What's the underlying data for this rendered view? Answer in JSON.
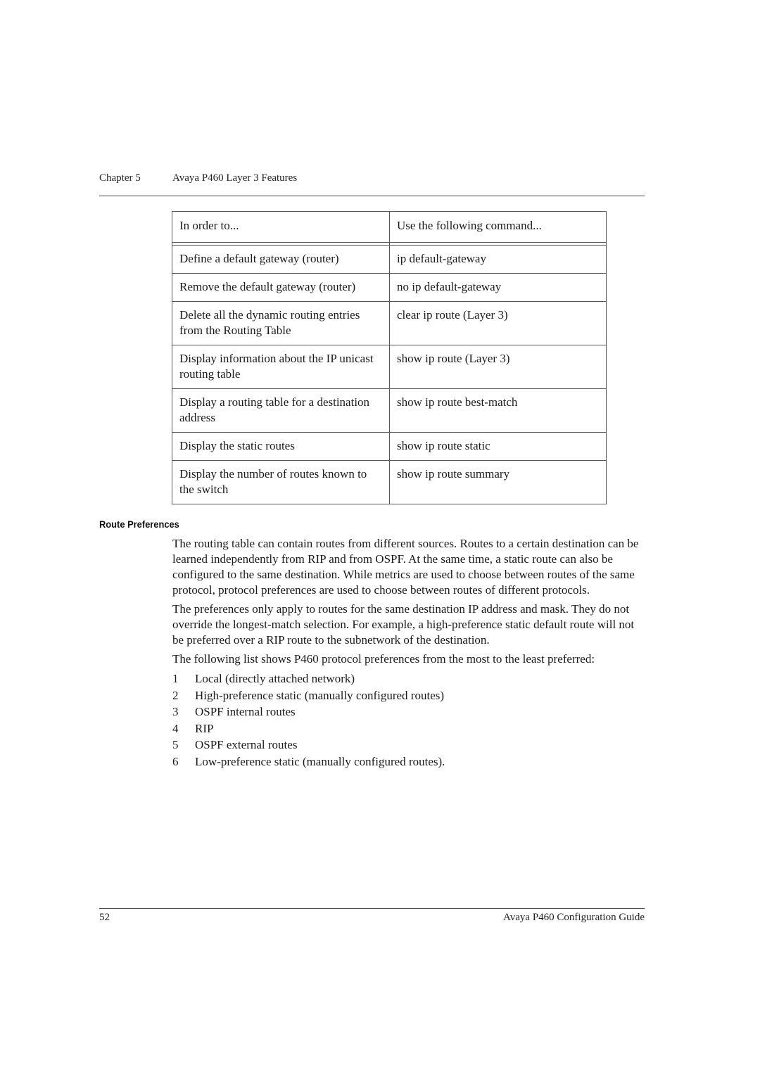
{
  "header": {
    "chapter": "Chapter 5",
    "title": "Avaya P460 Layer 3 Features"
  },
  "table": {
    "headers": [
      "In order to...",
      "Use the following command..."
    ],
    "rows": [
      {
        "action": "Define a default gateway (router)",
        "command": "ip default-gateway"
      },
      {
        "action": "Remove the default gateway (router)",
        "command": "no ip default-gateway"
      },
      {
        "action": "Delete all the dynamic routing entries from the Routing Table",
        "command": "clear ip route (Layer 3)"
      },
      {
        "action": "Display information about the IP unicast routing table",
        "command": "show ip route (Layer 3)"
      },
      {
        "action": "Display a routing table for a destination address",
        "command": "show ip route best-match"
      },
      {
        "action": "Display the static routes",
        "command": "show ip route static"
      },
      {
        "action": "Display the number of routes known to the switch",
        "command": "show ip route summary"
      }
    ]
  },
  "section": {
    "title": "Route Preferences",
    "paragraphs": [
      "The routing table can contain routes from different sources. Routes to a certain destination can be learned independently from RIP and from OSPF. At the same time, a static route can also be configured to the same destination. While metrics are used to choose between routes of the same protocol, protocol preferences are used to choose between routes of different protocols.",
      "The preferences only apply to routes for the same destination IP address and mask. They do not override the longest-match selection. For example, a high-preference static default route will not be preferred over a RIP route to the subnetwork of the destination.",
      "The following list shows P460 protocol preferences from the most to the least preferred:"
    ],
    "list": [
      {
        "num": "1",
        "text": "Local (directly attached network)"
      },
      {
        "num": "2",
        "text": "High-preference static (manually configured routes)"
      },
      {
        "num": "3",
        "text": "OSPF internal routes"
      },
      {
        "num": "4",
        "text": "RIP"
      },
      {
        "num": "5",
        "text": "OSPF external routes"
      },
      {
        "num": "6",
        "text": "Low-preference static (manually configured routes)."
      }
    ]
  },
  "footer": {
    "page_number": "52",
    "doc_title": "Avaya P460 Configuration Guide"
  }
}
